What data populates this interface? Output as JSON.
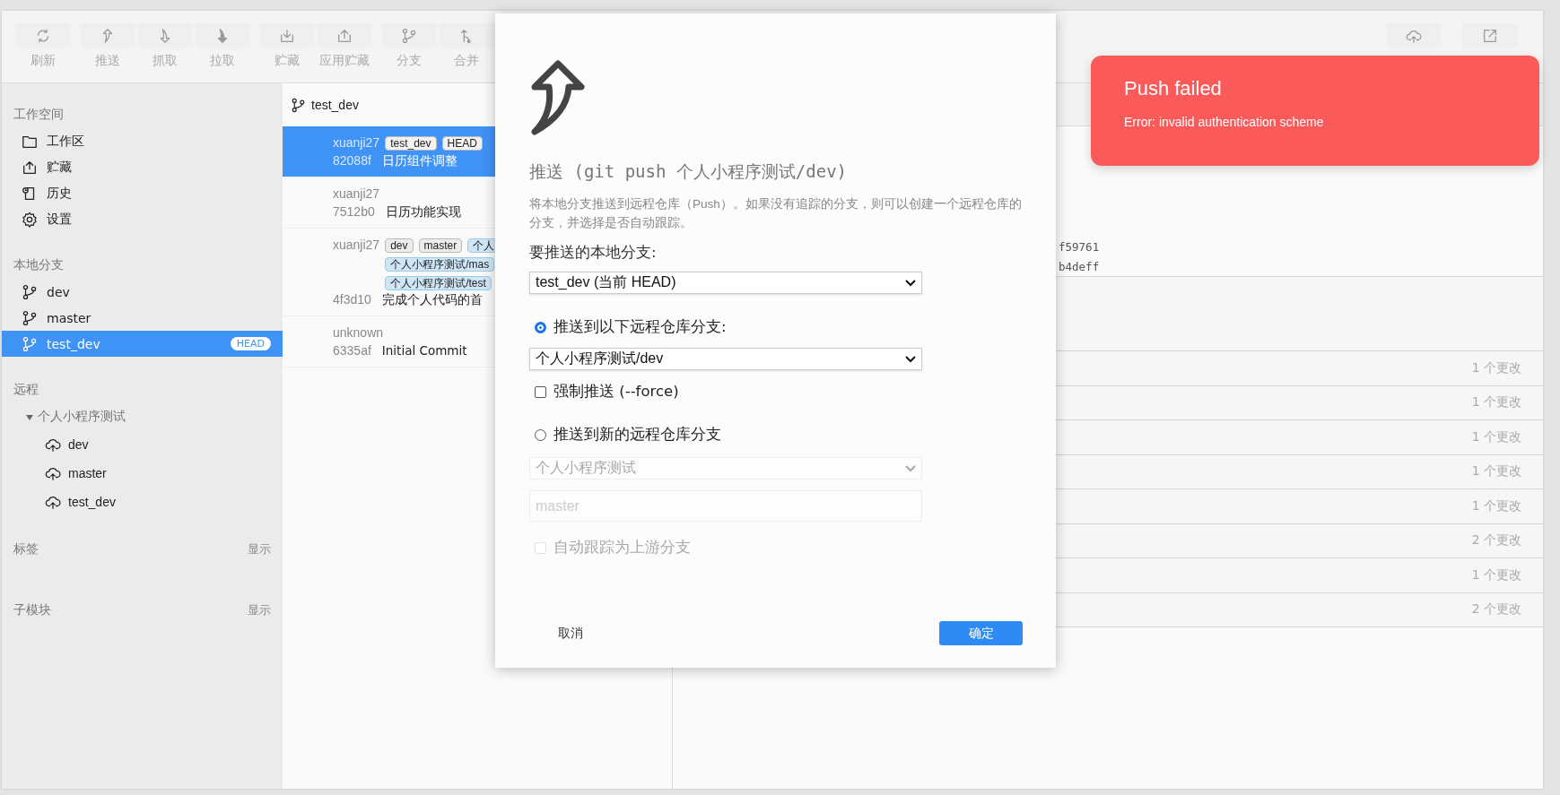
{
  "toolbar": {
    "groups": [
      [
        {
          "label": "刷新",
          "kind": "refresh"
        }
      ],
      [
        {
          "label": "推送",
          "kind": "push"
        },
        {
          "label": "抓取",
          "kind": "fetch"
        },
        {
          "label": "拉取",
          "kind": "pull"
        }
      ],
      [
        {
          "label": "贮藏",
          "kind": "stash"
        },
        {
          "label": "应用贮藏",
          "kind": "apply"
        }
      ],
      [
        {
          "label": "分支",
          "kind": "branch"
        },
        {
          "label": "合并",
          "kind": "merge"
        }
      ]
    ],
    "right_buttons": [
      {
        "kind": "cloud"
      },
      {
        "kind": "external"
      }
    ]
  },
  "sidebar": {
    "sections": [
      {
        "title": "工作空间",
        "items": [
          {
            "label": "工作区",
            "kind": "folder",
            "selected": false
          },
          {
            "label": "贮藏",
            "kind": "tray",
            "selected": false
          },
          {
            "label": "历史",
            "kind": "history",
            "selected": false
          },
          {
            "label": "设置",
            "kind": "gear",
            "selected": false
          }
        ]
      },
      {
        "title": "本地分支",
        "items": [
          {
            "label": "dev",
            "kind": "branch",
            "selected": false
          },
          {
            "label": "master",
            "kind": "branch",
            "selected": false
          },
          {
            "label": "test_dev",
            "kind": "branch",
            "selected": true,
            "badge": "HEAD"
          }
        ]
      },
      {
        "title": "远程",
        "tree": [
          {
            "label": "个人小程序测试",
            "expanded": true,
            "children": [
              {
                "label": "dev"
              },
              {
                "label": "master"
              },
              {
                "label": "test_dev"
              }
            ]
          }
        ]
      },
      {
        "title": "标签",
        "action": "显示"
      },
      {
        "title": "子模块",
        "action": "显示"
      }
    ]
  },
  "commit_list": {
    "branch": "test_dev",
    "commits": [
      {
        "author": "xuanji27",
        "refs": [
          {
            "label": "test_dev",
            "kind": "local"
          },
          {
            "label": "HEAD",
            "kind": "local"
          }
        ],
        "hash": "82088f",
        "message": "日历组件调整",
        "selected": true
      },
      {
        "author": "xuanji27",
        "hash": "7512b0",
        "message": "日历功能实现",
        "selected": false
      },
      {
        "author": "xuanji27",
        "refs": [
          {
            "label": "dev",
            "kind": "local"
          },
          {
            "label": "master",
            "kind": "local"
          },
          {
            "label": "个人",
            "kind": "remote"
          },
          {
            "label": "个人小程序测试/mas",
            "kind": "remote"
          },
          {
            "label": "个人小程序测试/test",
            "kind": "remote"
          }
        ],
        "hash": "4f3d10",
        "message": "完成个人代码的首",
        "selected": false
      },
      {
        "author": "unknown",
        "hash": "6335af",
        "message": "Initial Commit",
        "selected": false
      }
    ]
  },
  "details": {
    "hashes": [
      "f59761",
      "b4deff"
    ],
    "changes": [
      "1 个更改",
      "1 个更改",
      "1 个更改",
      "1 个更改",
      "1 个更改",
      "2 个更改",
      "1 个更改",
      "2 个更改"
    ]
  },
  "dialog": {
    "title": "推送 (git push 个人小程序测试/dev)",
    "description": "将本地分支推送到远程仓库（Push）。如果没有追踪的分支，则可以创建一个远程仓库的分支，并选择是否自动跟踪。",
    "local_branch_label": "要推送的本地分支:",
    "local_branch": "test_dev (当前 HEAD)",
    "options": [
      {
        "label": "推送到以下远程仓库分支:",
        "selected": true
      },
      {
        "label": "推送到新的远程仓库分支",
        "selected": false
      }
    ],
    "remote_branch": "个人小程序测试/dev",
    "force": {
      "label": "强制推送 (--force)",
      "checked": false
    },
    "new_remote": {
      "remote": "个人小程序测试",
      "placeholder": "master",
      "disabled": true
    },
    "track": {
      "label": "自动跟踪为上游分支",
      "checked": false,
      "disabled": true
    },
    "buttons": [
      {
        "label": "取消",
        "kind": "cancel"
      },
      {
        "label": "确定",
        "kind": "primary"
      }
    ]
  },
  "toast": {
    "title": "Push failed",
    "message": "Error: invalid authentication scheme"
  }
}
